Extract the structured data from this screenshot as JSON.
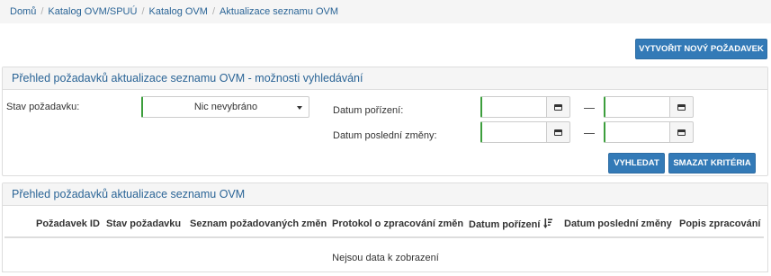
{
  "breadcrumb": {
    "items": [
      "Domů",
      "Katalog OVM/SPUÚ",
      "Katalog OVM",
      "Aktualizace seznamu OVM"
    ],
    "separator": "/"
  },
  "toolbar": {
    "new_request_label": "VYTVOŘIT NOVÝ POŽADAVEK"
  },
  "search_panel": {
    "title": "Přehled požadavků aktualizace seznamu OVM - možnosti vyhledávání",
    "status_label": "Stav požadavku:",
    "status_value": "Nic nevybráno",
    "acquired_label": "Datum pořízení:",
    "last_change_label": "Datum poslední změny:",
    "search_button": "VYHLEDAT",
    "clear_button": "SMAZAT KRITÉRIA"
  },
  "results_panel": {
    "title": "Přehled požadavků aktualizace seznamu OVM",
    "columns": [
      "Požadavek ID",
      "Stav požadavku",
      "Seznam požadovaných změn",
      "Protokol o zpracování změn",
      "Datum pořízení",
      "Datum poslední změny",
      "Popis zpracování"
    ],
    "empty_text": "Nejsou data k zobrazení"
  },
  "colors": {
    "accent": "#337ab7",
    "link": "#2a6496",
    "required_border": "#3c9e3c"
  },
  "icons": {
    "calendar": "calendar-icon",
    "sort": "sort-descending-icon",
    "caret": "chevron-down-icon"
  }
}
